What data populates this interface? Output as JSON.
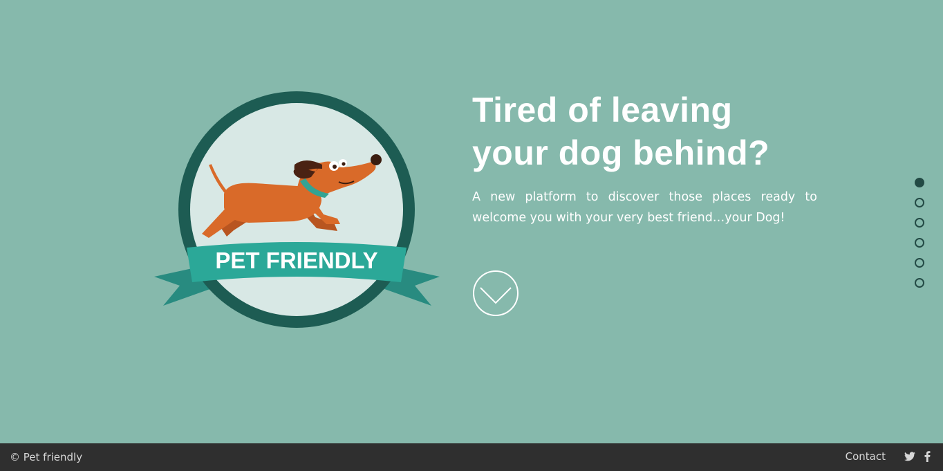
{
  "hero": {
    "title": "Tired of leaving\nyour dog behind?",
    "description": "A new platform to discover those places ready to welcome you with your very best friend…your Dog!"
  },
  "badge": {
    "ribbon_text": "PET FRIENDLY"
  },
  "scroll_button": {
    "icon": "chevron-down-icon"
  },
  "section_nav": {
    "count": 6,
    "active_index": 0
  },
  "footer": {
    "copyright": "© Pet friendly",
    "contact_label": "Contact",
    "social": [
      "twitter-icon",
      "facebook-icon"
    ]
  },
  "colors": {
    "background": "#86b9ac",
    "footer": "#2f2f2f",
    "badge_ring": "#1d5c53",
    "badge_inner": "#d8e8e5",
    "ribbon": "#2ba898",
    "dog": "#d96a29"
  }
}
